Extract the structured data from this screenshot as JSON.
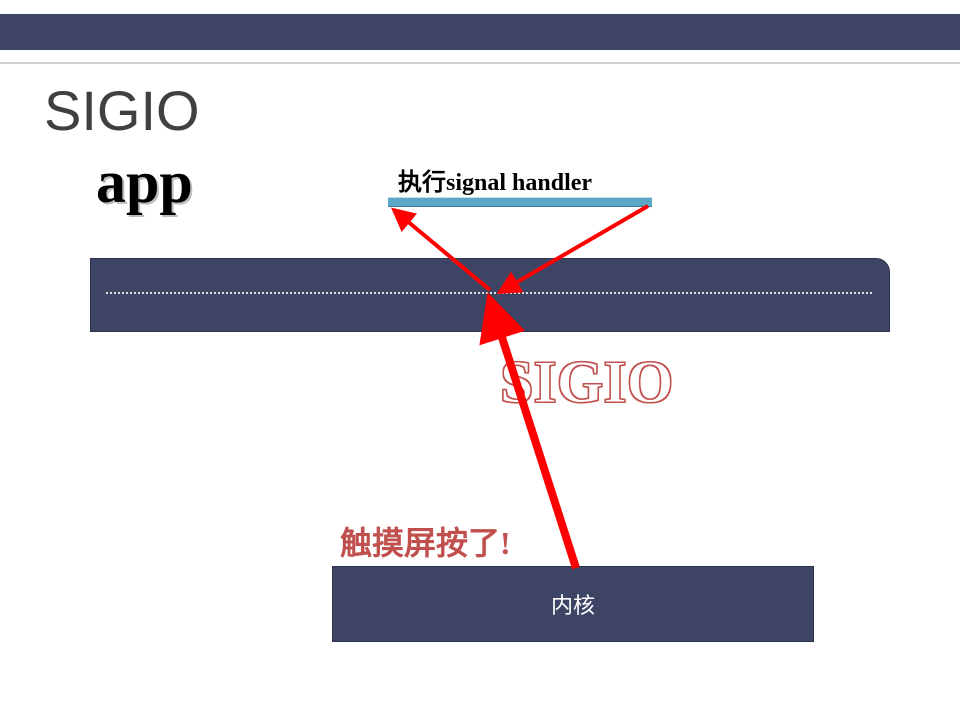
{
  "title": "SIGIO",
  "app_label": "app",
  "signal_handler_label": "执行signal handler",
  "sigio_label": "SIGIO",
  "touch_label": "触摸屏按了!",
  "kernel_label": "内核",
  "colors": {
    "bar": "#3d4464",
    "arrow": "#ff0000",
    "sigio_outline": "#c0504d",
    "handler_bar": "#5aa7c6"
  },
  "chart_data": {
    "type": "diagram",
    "title": "SIGIO",
    "nodes": [
      {
        "id": "app",
        "label": "app"
      },
      {
        "id": "signal_handler",
        "label": "执行signal handler"
      },
      {
        "id": "app_timeline",
        "label": ""
      },
      {
        "id": "kernel",
        "label": "内核"
      }
    ],
    "edges": [
      {
        "from": "kernel",
        "to": "app_timeline",
        "label": "SIGIO",
        "note": "触摸屏按了!"
      },
      {
        "from": "app_timeline",
        "to": "signal_handler",
        "label": ""
      },
      {
        "from": "signal_handler",
        "to": "app_timeline",
        "label": ""
      }
    ]
  }
}
